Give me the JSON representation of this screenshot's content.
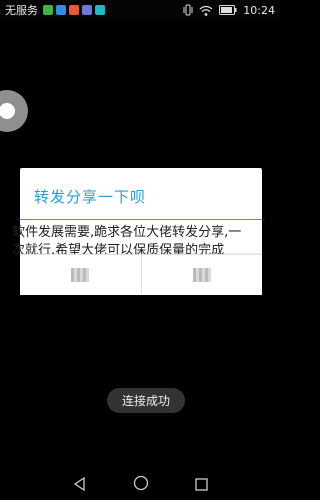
{
  "status_bar": {
    "carrier": "无服务",
    "time": "10:24",
    "app_icons": [
      {
        "name": "wechat-icon",
        "color": "#3fb73f"
      },
      {
        "name": "message-icon",
        "color": "#2f8fe8"
      },
      {
        "name": "mail-icon",
        "color": "#e85a2f"
      },
      {
        "name": "photo-icon",
        "color": "#6e7bd8"
      },
      {
        "name": "app-icon",
        "color": "#1eb8c8"
      }
    ]
  },
  "dialog": {
    "title": "转发分享一下呗",
    "message": "软件发展需要,跪求各位大佬转发分享,一次就行,希望大佬可以保质保量的完成",
    "buttons": [
      {
        "label": "取消"
      },
      {
        "label": "确定"
      }
    ],
    "accent_color": "#1fa3e0"
  },
  "toast": {
    "text": "连接成功"
  }
}
